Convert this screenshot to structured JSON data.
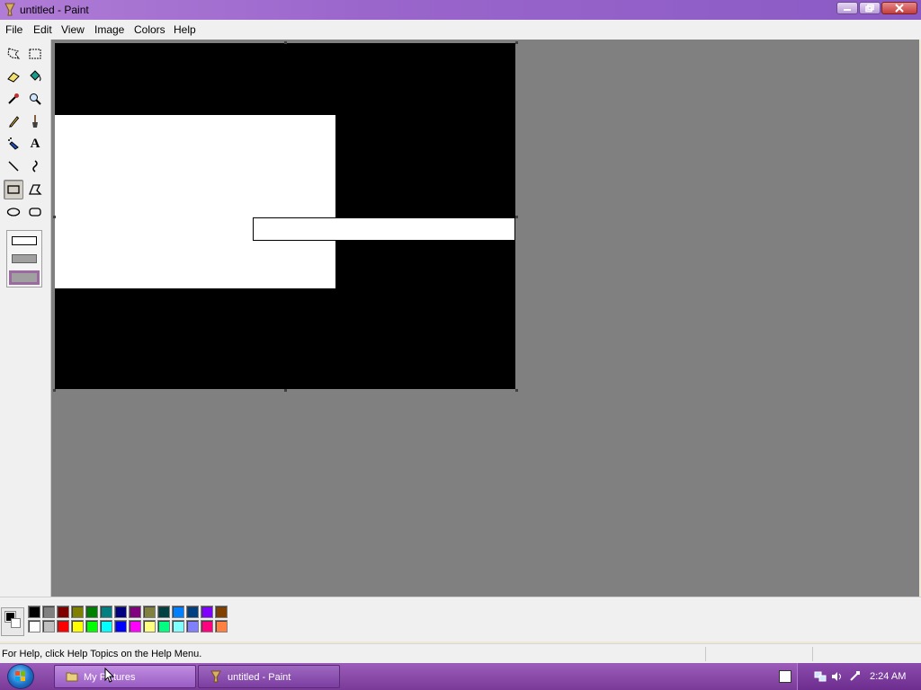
{
  "window": {
    "title": "untitled - Paint"
  },
  "menu": {
    "items": [
      "File",
      "Edit",
      "View",
      "Image",
      "Colors",
      "Help"
    ]
  },
  "tools": [
    {
      "name": "free-form-select-icon",
      "selected": false
    },
    {
      "name": "select-icon",
      "selected": false
    },
    {
      "name": "eraser-icon",
      "selected": false
    },
    {
      "name": "fill-with-color-icon",
      "selected": false
    },
    {
      "name": "pick-color-icon",
      "selected": false
    },
    {
      "name": "magnifier-icon",
      "selected": false
    },
    {
      "name": "pencil-icon",
      "selected": false
    },
    {
      "name": "brush-icon",
      "selected": false
    },
    {
      "name": "airbrush-icon",
      "selected": false
    },
    {
      "name": "text-icon",
      "selected": false,
      "glyph": "A"
    },
    {
      "name": "line-icon",
      "selected": false
    },
    {
      "name": "curve-icon",
      "selected": false
    },
    {
      "name": "rectangle-icon",
      "selected": true
    },
    {
      "name": "polygon-icon",
      "selected": false
    },
    {
      "name": "ellipse-icon",
      "selected": false
    },
    {
      "name": "rounded-rectangle-icon",
      "selected": false
    }
  ],
  "tool_options": [
    "outline-only",
    "outline-and-fill",
    "fill-only"
  ],
  "selected_tool_option": 2,
  "colors": {
    "foreground": "#000000",
    "background": "#ffffff",
    "palette_top": [
      "#000000",
      "#808080",
      "#800000",
      "#808000",
      "#008000",
      "#008080",
      "#000080",
      "#800080",
      "#808040",
      "#004040",
      "#0080ff",
      "#004080",
      "#8000ff",
      "#804000"
    ],
    "palette_bottom": [
      "#ffffff",
      "#c0c0c0",
      "#ff0000",
      "#ffff00",
      "#00ff00",
      "#00ffff",
      "#0000ff",
      "#ff00ff",
      "#ffff80",
      "#00ff80",
      "#80ffff",
      "#8080ff",
      "#ff0080",
      "#ff8040"
    ]
  },
  "status": {
    "help_text": "For Help, click Help Topics on the Help Menu."
  },
  "taskbar": {
    "buttons": [
      {
        "label": "My Pictures",
        "icon": "folder-icon"
      },
      {
        "label": "untitled - Paint",
        "icon": "paint-icon"
      }
    ],
    "clock": "2:24 AM"
  }
}
